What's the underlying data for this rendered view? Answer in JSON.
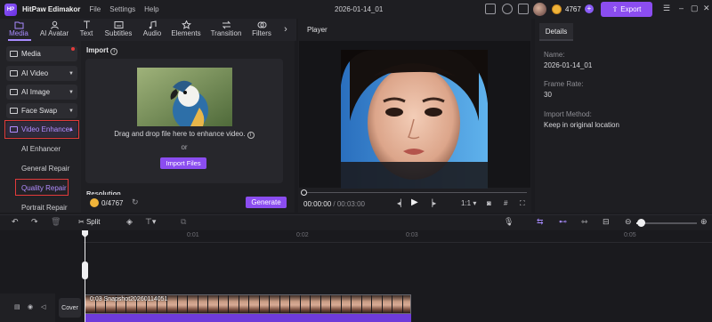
{
  "app": {
    "title": "HitPaw Edimakor",
    "menu": [
      "File",
      "Settings",
      "Help"
    ],
    "project_name": "2026-01-14_01",
    "credits": "4767",
    "export_label": "Export",
    "accent_color": "#8b4df0"
  },
  "toolbar": {
    "tabs": [
      "Media",
      "AI Avatar",
      "Text",
      "Subtitles",
      "Audio",
      "Elements",
      "Transition",
      "Filters"
    ],
    "active": "Media"
  },
  "sidebar": {
    "items": [
      {
        "label": "Media"
      },
      {
        "label": "AI Video"
      },
      {
        "label": "AI Image"
      },
      {
        "label": "Face Swap"
      },
      {
        "label": "Video Enhancer"
      }
    ],
    "subitems": [
      "AI Enhancer",
      "General Repair",
      "Quality Repair",
      "Portrait Repair"
    ],
    "highlighted": [
      "Video Enhancer",
      "Quality Repair"
    ]
  },
  "import": {
    "header": "Import",
    "drop_text": "Drag and drop file here to enhance video.",
    "or_text": "or",
    "button": "Import Files",
    "resolution_label": "Resolution",
    "credits": "0/4767",
    "generate": "Generate"
  },
  "player": {
    "header": "Player",
    "time_current": "00:00:00",
    "time_total": "/ 00:03:00",
    "ratio": "1:1"
  },
  "details": {
    "tab": "Details",
    "name_label": "Name:",
    "name_value": "2026-01-14_01",
    "frame_rate_label": "Frame Rate:",
    "frame_rate_value": "30",
    "import_method_label": "Import Method:",
    "import_method_value": "Keep in original location"
  },
  "timeline": {
    "split_label": "Split",
    "ruler": [
      "0:01",
      "0:02",
      "0:03",
      "0:05"
    ],
    "cover_label": "Cover",
    "clip_label": "0:03 Snapshot20260114051"
  }
}
